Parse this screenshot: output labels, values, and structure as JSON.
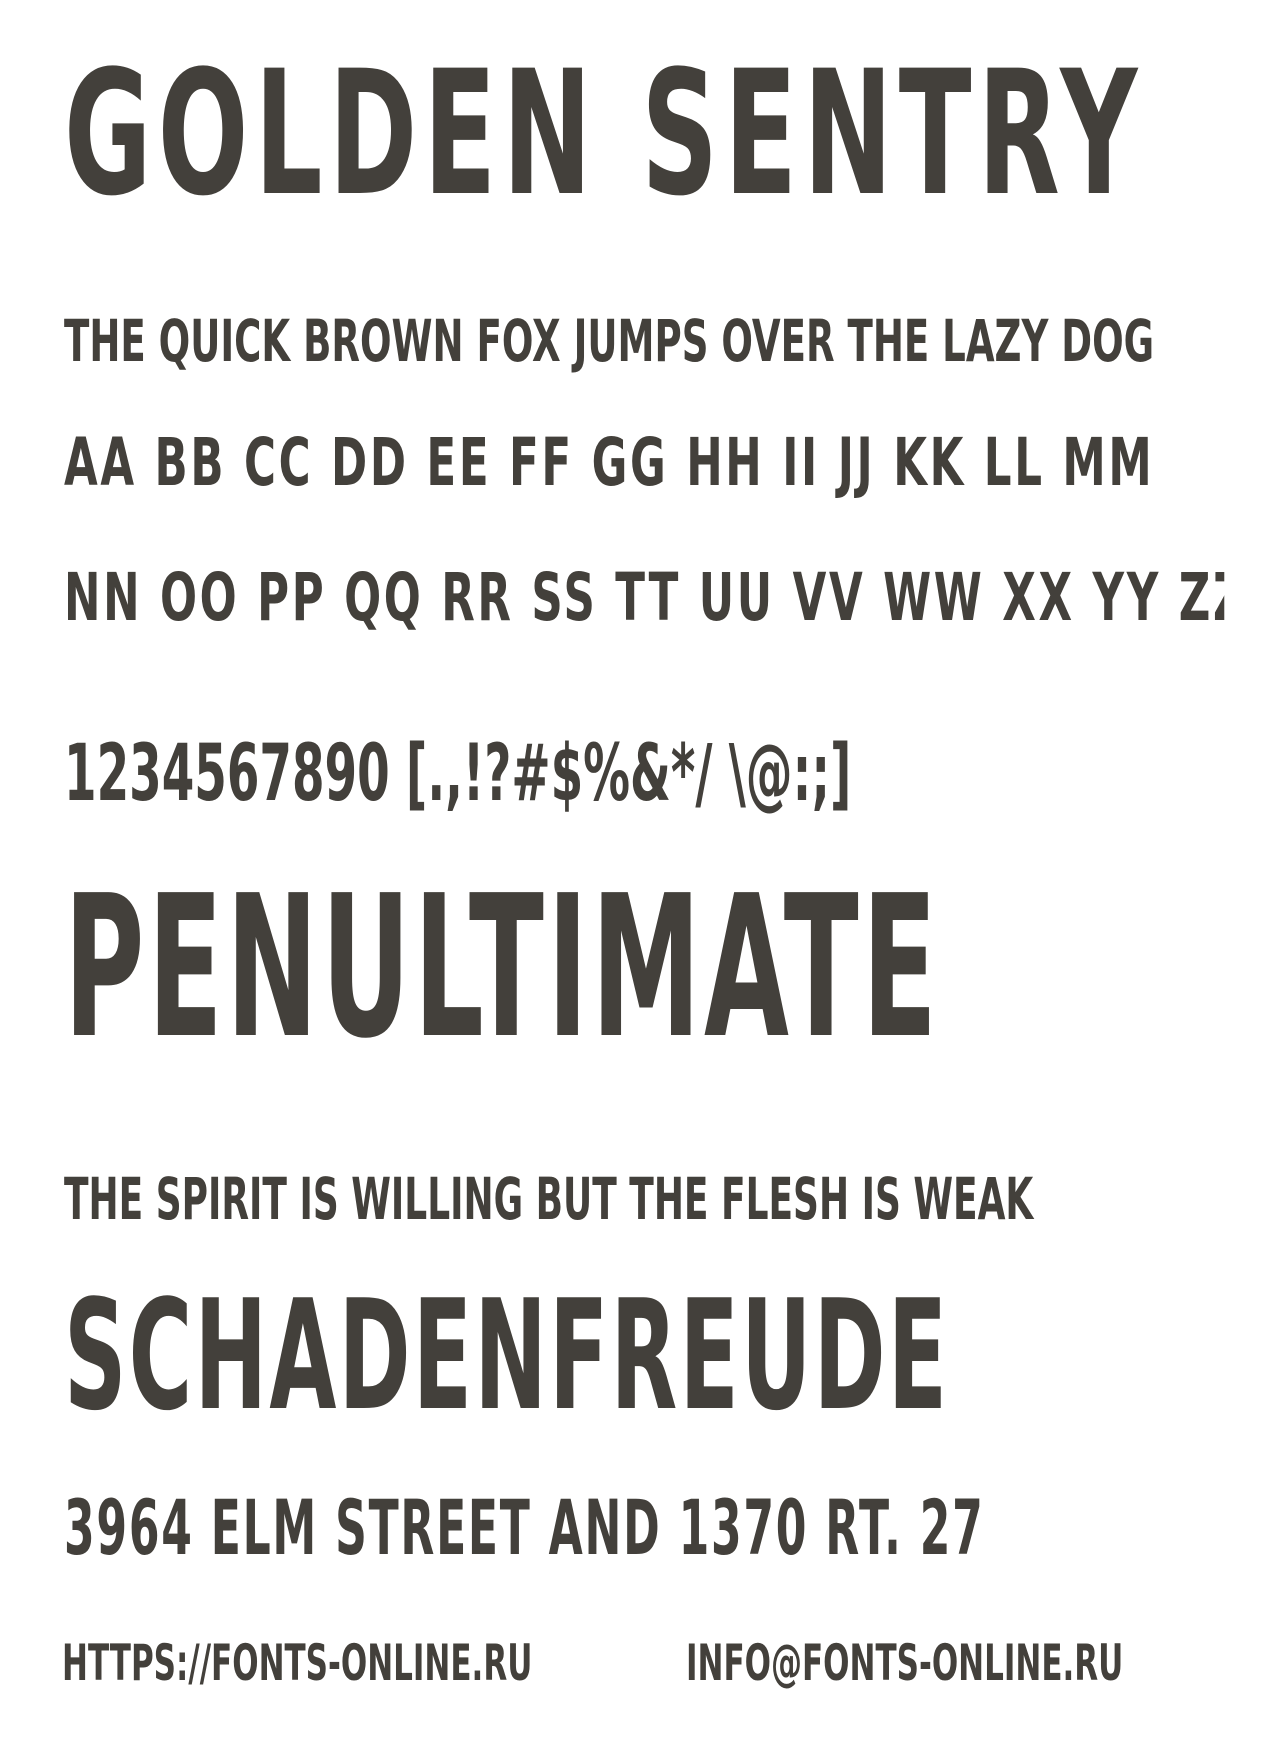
{
  "sample": {
    "title": "Golden Sentry",
    "pangram": "The quick brown fox jumps over the lazy dog",
    "alphabet_line_1": "Aa Bb Cc Dd Ee Ff Gg Hh Ii Jj Kk Ll Mm",
    "alphabet_line_2": "Nn Oo Pp Qq Rr Ss Tt Uu Vv Ww Xx Yy Zz",
    "symbols_line": "1234567890 [.,!?#$%&*/ \\@:;]",
    "word_1": "Penultimate",
    "proverb": "The spirit is willing but the flesh is weak",
    "word_2": "SCHADENFREUDE",
    "address": "3964 Elm Street and 1370 Rt. 27"
  },
  "footer": {
    "url": "https://fonts-online.ru",
    "email": "info@fonts-online.ru"
  },
  "colors": {
    "text": "#43403b",
    "background": "#ffffff"
  }
}
